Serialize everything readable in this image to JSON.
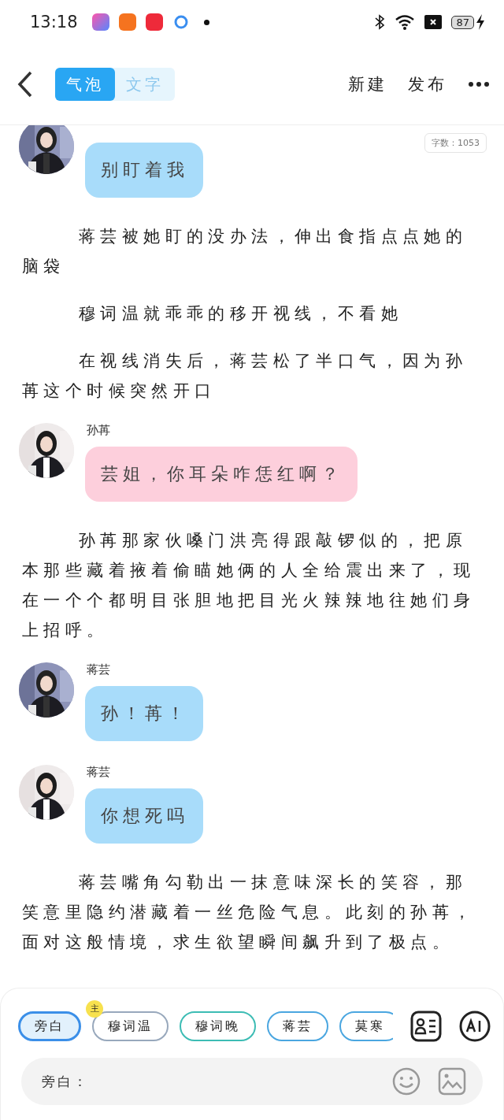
{
  "status_bar": {
    "time": "13:18",
    "battery": "87"
  },
  "header": {
    "tabs": [
      {
        "label": "气泡",
        "selected": true
      },
      {
        "label": "文字",
        "selected": false
      }
    ],
    "actions": [
      "新建",
      "发布"
    ]
  },
  "word_count": "字数：1053",
  "messages": [
    {
      "kind": "bubble",
      "text": "别盯着我",
      "color": "#a8dcfa"
    },
    {
      "kind": "narration",
      "text": "蒋芸被她盯的没办法，伸出食指点点她的脑袋"
    },
    {
      "kind": "narration",
      "text": "穆词温就乖乖的移开视线，不看她"
    },
    {
      "kind": "narration",
      "text": "在视线消失后，蒋芸松了半口气，因为孙苒这个时候突然开口"
    },
    {
      "kind": "bubble",
      "speaker": "孙苒",
      "text": "芸姐，你耳朵咋恁红啊？",
      "color": "#fdcfdc"
    },
    {
      "kind": "narration",
      "text": "孙苒那家伙嗓门洪亮得跟敲锣似的，把原本那些藏着掖着偷瞄她俩的人全给震出来了，现在一个个都明目张胆地把目光火辣辣地往她们身上招呼。"
    },
    {
      "kind": "bubble",
      "speaker": "蒋芸",
      "text": "孙！苒！",
      "color": "#a8dcfa"
    },
    {
      "kind": "bubble",
      "speaker": "蒋芸",
      "text": "你想死吗",
      "color": "#a8dcfa"
    },
    {
      "kind": "narration",
      "text": "蒋芸嘴角勾勒出一抹意味深长的笑容，那笑意里隐约潜藏着一丝危险气息。此刻的孙苒，面对这般情境，求生欲望瞬间飙升到了极点。"
    }
  ],
  "roles": [
    {
      "label": "旁白",
      "selected": true,
      "color": "#3b8fe8"
    },
    {
      "label": "穆词温",
      "selected": false,
      "color": "#98a8bc",
      "badge": "主"
    },
    {
      "label": "穆词晚",
      "selected": false,
      "color": "#3cbcb4"
    },
    {
      "label": "蒋芸",
      "selected": false,
      "color": "#4aa6e0"
    },
    {
      "label": "莫寒",
      "selected": false,
      "color": "#4aa6e0"
    }
  ],
  "input": {
    "placeholder": "旁白："
  }
}
